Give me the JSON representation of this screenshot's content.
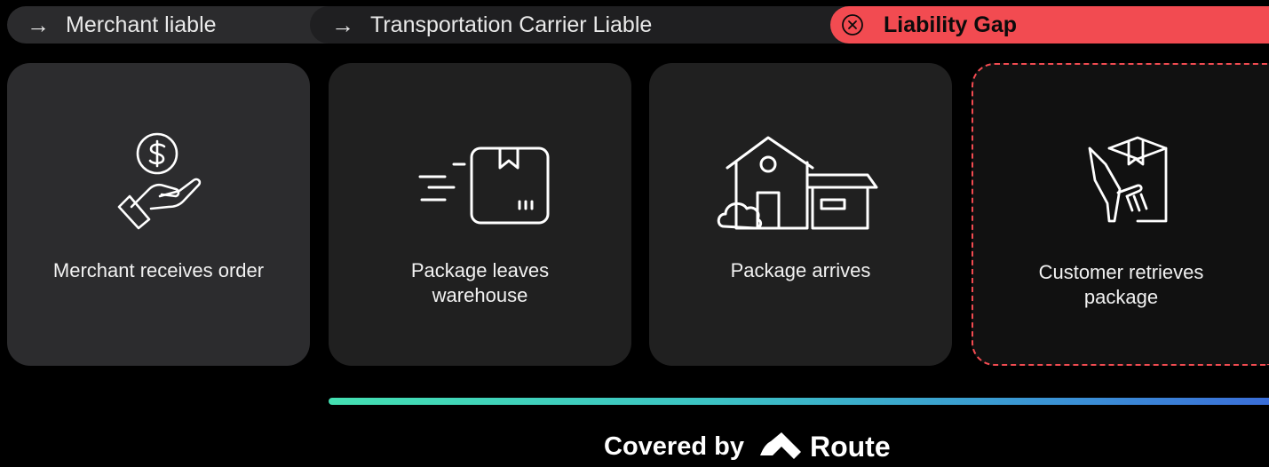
{
  "phases": {
    "merchant": {
      "label": "Merchant liable",
      "icon": "right-arrow-icon"
    },
    "carrier": {
      "label": "Transportation Carrier Liable",
      "icon": "right-arrow-icon"
    },
    "gap": {
      "label": "Liability Gap",
      "icon": "x-circle-icon",
      "color": "#f24b51"
    }
  },
  "steps": [
    {
      "label": "Merchant receives order",
      "icon": "hand-dollar-icon"
    },
    {
      "label": "Package leaves warehouse",
      "icon": "moving-box-icon"
    },
    {
      "label": "Package arrives",
      "icon": "house-icon"
    },
    {
      "label": "Customer retrieves package",
      "icon": "hand-package-icon"
    }
  ],
  "coverage": {
    "prefix": "Covered by",
    "brand": "Route",
    "brand_icon": "route-logo-icon"
  },
  "colors": {
    "gap_red": "#f24b51",
    "gradient_start": "#44e0b2",
    "gradient_end": "#3a6ed8"
  }
}
